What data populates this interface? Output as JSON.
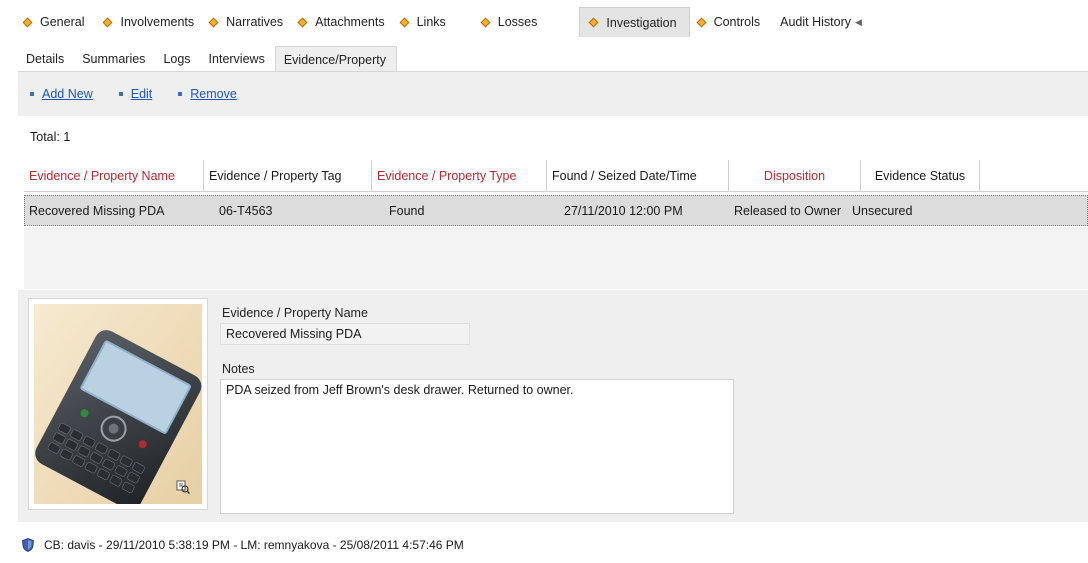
{
  "top_tabs": [
    {
      "label": "General"
    },
    {
      "label": "Involvements"
    },
    {
      "label": "Narratives"
    },
    {
      "label": "Attachments"
    },
    {
      "label": "Links"
    },
    {
      "label": "Losses"
    },
    {
      "label": "Investigation"
    },
    {
      "label": "Controls"
    },
    {
      "label": "Audit History"
    }
  ],
  "sub_tabs": [
    {
      "label": "Details"
    },
    {
      "label": "Summaries"
    },
    {
      "label": "Logs"
    },
    {
      "label": "Interviews"
    },
    {
      "label": "Evidence/Property"
    }
  ],
  "toolbar": {
    "add_new": "Add New",
    "edit": "Edit",
    "remove": "Remove"
  },
  "total": "Total: 1",
  "grid": {
    "columns": [
      "Evidence / Property Name",
      "Evidence / Property Tag",
      "Evidence / Property Type",
      "Found / Seized Date/Time",
      "Disposition",
      "Evidence Status"
    ],
    "rows": [
      {
        "name": "Recovered Missing PDA",
        "tag": "06-T4563",
        "type": "Found",
        "datetime": "27/11/2010  12:00 PM",
        "disposition": "Released to Owner",
        "status": "Unsecured"
      }
    ]
  },
  "detail": {
    "name_label": "Evidence / Property Name",
    "name_value": "Recovered Missing PDA",
    "notes_label": "Notes",
    "notes_value": "PDA seized from Jeff Brown's desk drawer. Returned to owner."
  },
  "footer": "CB: davis - 29/11/2010 5:38:19 PM - LM: remnyakova - 25/08/2011 4:57:46 PM",
  "colors": {
    "required_header": "#c0282d",
    "link": "#1c55c7",
    "tab_diamond": "#f3b12b"
  }
}
